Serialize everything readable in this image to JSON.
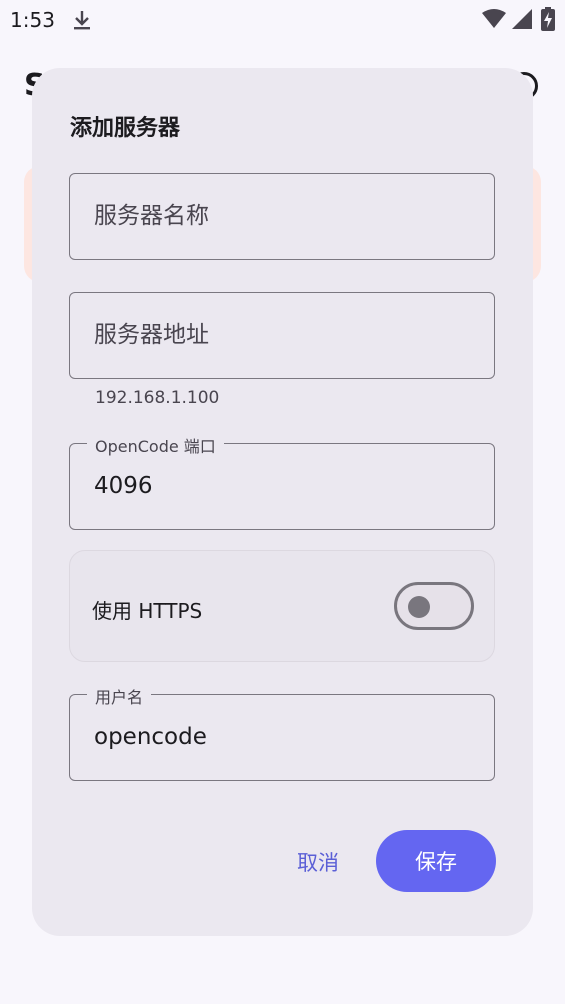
{
  "status_bar": {
    "time": "1:53"
  },
  "background": {
    "title_fragment": "S"
  },
  "dialog": {
    "title": "添加服务器",
    "name_field": {
      "placeholder": "服务器名称",
      "value": ""
    },
    "address_field": {
      "placeholder": "服务器地址",
      "value": "",
      "hint": "192.168.1.100"
    },
    "port_field": {
      "label": "OpenCode 端口",
      "value": "4096"
    },
    "https": {
      "label": "使用 HTTPS",
      "enabled": false
    },
    "username_field": {
      "label": "用户名",
      "value": "opencode"
    },
    "cancel_label": "取消",
    "save_label": "保存"
  },
  "colors": {
    "accent": "#6466f1",
    "accent_text": "#5b5fd6",
    "dialog_bg": "#ebe8f0",
    "outline": "#7a7780"
  }
}
